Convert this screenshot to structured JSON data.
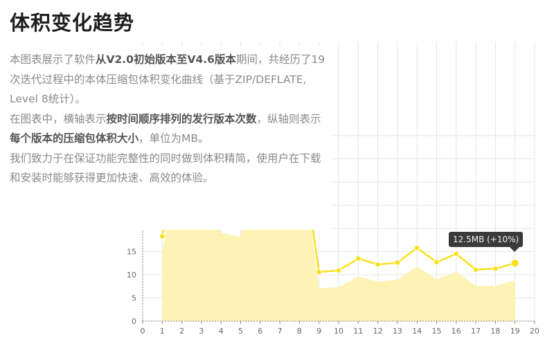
{
  "header": {
    "title": "体积变化趋势"
  },
  "description": {
    "p1_a": "本图表展示了软件",
    "p1_b": "从V2.0初始版本至V4.6版本",
    "p1_c": "期间，共经历了19次迭代过程中的本体压缩包体积变化曲线（基于ZIP/DEFLATE, Level 8统计）。",
    "p2_a": "在图表中，横轴表示",
    "p2_b": "按时间顺序排列的发行版本次数",
    "p2_c": "，纵轴则表示",
    "p2_d": "每个版本的压缩包体积大小",
    "p2_e": "，单位为MB。",
    "p3": "我们致力于在保证功能完整性的同时做到体积精简，使用户在下载和安装时能够获得更加快速、高效的体验。"
  },
  "tooltip": {
    "text": "12.5MB (+10%)"
  },
  "colors": {
    "line": "#f7e11a",
    "area": "#fdf3b4",
    "grid": "#e6e6e6",
    "tooltip_bg": "#3a3a3a"
  },
  "chart_data": {
    "type": "line",
    "x": [
      1,
      2,
      3,
      4,
      5,
      6,
      7,
      8,
      9,
      10,
      11,
      12,
      13,
      14,
      15,
      16,
      17,
      18,
      19
    ],
    "series": [
      {
        "values": [
          18.3,
          null,
          null,
          null,
          null,
          null,
          null,
          null,
          10.6,
          10.9,
          13.5,
          12.2,
          12.6,
          15.8,
          12.7,
          14.5,
          11.1,
          11.3,
          12.5
        ]
      }
    ],
    "area": [
      15.0,
      null,
      null,
      19.0,
      18.2,
      null,
      null,
      null,
      7.1,
      7.3,
      9.6,
      8.5,
      8.9,
      11.8,
      9.0,
      10.6,
      7.6,
      7.6,
      8.8
    ],
    "xlim": [
      0,
      20
    ],
    "ylim": [
      0,
      40
    ],
    "x_ticks": [
      0,
      1,
      2,
      3,
      4,
      5,
      6,
      7,
      8,
      9,
      10,
      11,
      12,
      13,
      14,
      15,
      16,
      17,
      18,
      19,
      20
    ],
    "y_ticks": [
      0,
      5,
      10,
      15
    ],
    "highlight_x": 19,
    "grid": true
  }
}
